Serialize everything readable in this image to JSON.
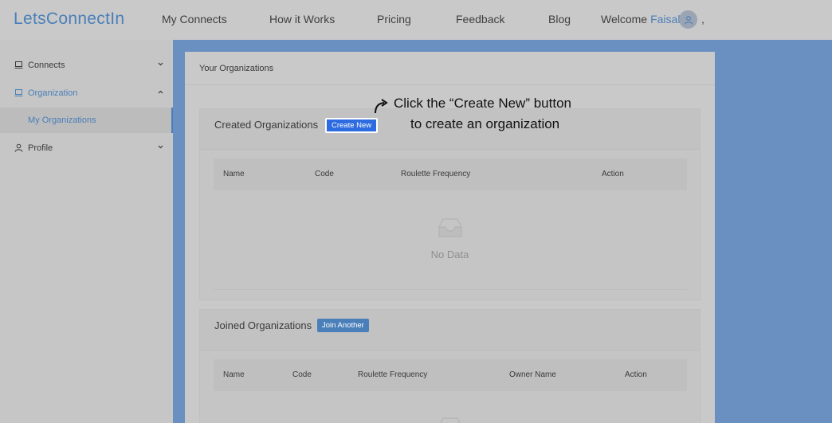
{
  "header": {
    "logo": "LetsConnectIn",
    "nav": [
      "My Connects",
      "How it Works",
      "Pricing",
      "Feedback",
      "Blog"
    ],
    "welcome_label": "Welcome",
    "user_name": "Faisal",
    "trailing": ","
  },
  "sidebar": {
    "items": [
      {
        "label": "Connects",
        "icon": "laptop-icon",
        "chevron": "chevron-down-icon"
      },
      {
        "label": "Organization",
        "icon": "laptop-icon",
        "chevron": "chevron-up-icon"
      },
      {
        "label": "Profile",
        "icon": "user-icon",
        "chevron": "chevron-down-icon"
      }
    ],
    "sub_item": "My Organizations"
  },
  "main": {
    "title": "Your Organizations",
    "created": {
      "title": "Created Organizations",
      "button": "Create New",
      "columns": [
        "Name",
        "Code",
        "Roulette Frequency",
        "Action"
      ],
      "empty_text": "No Data"
    },
    "joined": {
      "title": "Joined Organizations",
      "button": "Join Another",
      "columns": [
        "Name",
        "Code",
        "Roulette Frequency",
        "Owner Name",
        "Action"
      ]
    }
  },
  "annotation": {
    "line1": "Click the “Create New” button",
    "line2": "to create an organization"
  },
  "colors": {
    "accent": "#4a7fb9",
    "highlight_button": "#2d6be0",
    "background": "#6a90c2"
  }
}
